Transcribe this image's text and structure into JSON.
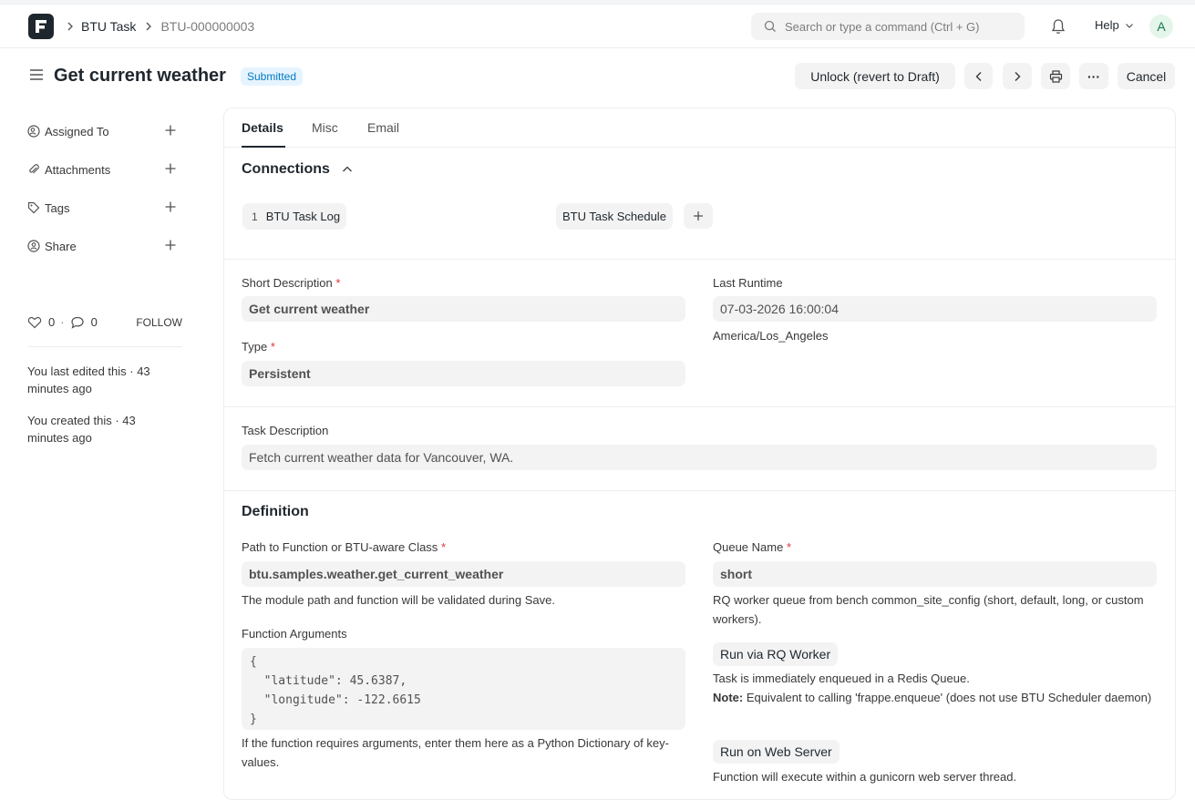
{
  "navbar": {
    "breadcrumb_doctype": "BTU Task",
    "breadcrumb_docname": "BTU-000000003",
    "search_placeholder": "Search or type a command (Ctrl + G)",
    "help_label": "Help",
    "avatar_initial": "A"
  },
  "header": {
    "title": "Get current weather",
    "status": "Submitted",
    "unlock_label": "Unlock (revert to Draft)",
    "cancel_label": "Cancel",
    "more_label": "···"
  },
  "sidebar": {
    "items": [
      {
        "label": "Assigned To"
      },
      {
        "label": "Attachments"
      },
      {
        "label": "Tags"
      },
      {
        "label": "Share"
      }
    ],
    "like_count": "0",
    "comment_count": "0",
    "separator": "·",
    "follow_label": "FOLLOW",
    "last_edited": "You last edited this · 43 minutes ago",
    "created": "You created this · 43 minutes ago"
  },
  "tabs": [
    {
      "label": "Details"
    },
    {
      "label": "Misc"
    },
    {
      "label": "Email"
    }
  ],
  "connections": {
    "title": "Connections",
    "items": [
      {
        "count": "1",
        "label": "BTU Task Log"
      },
      {
        "count": "",
        "label": "BTU Task Schedule"
      }
    ]
  },
  "fields": {
    "short_description_label": "Short Description",
    "short_description_value": "Get current weather",
    "last_runtime_label": "Last Runtime",
    "last_runtime_value": "07-03-2026 16:00:04",
    "timezone": "America/Los_Angeles",
    "type_label": "Type",
    "type_value": "Persistent",
    "task_description_label": "Task Description",
    "task_description_value": "Fetch current weather data for Vancouver, WA."
  },
  "definition": {
    "title": "Definition",
    "path_label": "Path to Function or BTU-aware Class",
    "path_value": "btu.samples.weather.get_current_weather",
    "path_help": "The module path and function will be validated during Save.",
    "args_label": "Function Arguments",
    "args_value": "{\n  \"latitude\": 45.6387,\n  \"longitude\": -122.6615\n}",
    "args_help": "If the function requires arguments, enter them here as a Python Dictionary of key-values.",
    "queue_label": "Queue Name",
    "queue_value": "short",
    "queue_help": "RQ worker queue from bench common_site_config (short, default, long, or custom workers).",
    "rq_worker_label": "Run via RQ Worker",
    "rq_worker_help": "Task is immediately enqueued in a Redis Queue.",
    "rq_note_label": "Note:",
    "rq_note_text": "Equivalent to calling 'frappe.enqueue' (does not use BTU Scheduler daemon)",
    "web_server_label": "Run on Web Server",
    "web_server_help": "Function will execute within a gunicorn web server thread."
  },
  "required_marker": "*",
  "colors": {
    "accent_badge_bg": "#e6f4ff",
    "accent_badge_fg": "#007bc5",
    "required": "#e03636"
  }
}
